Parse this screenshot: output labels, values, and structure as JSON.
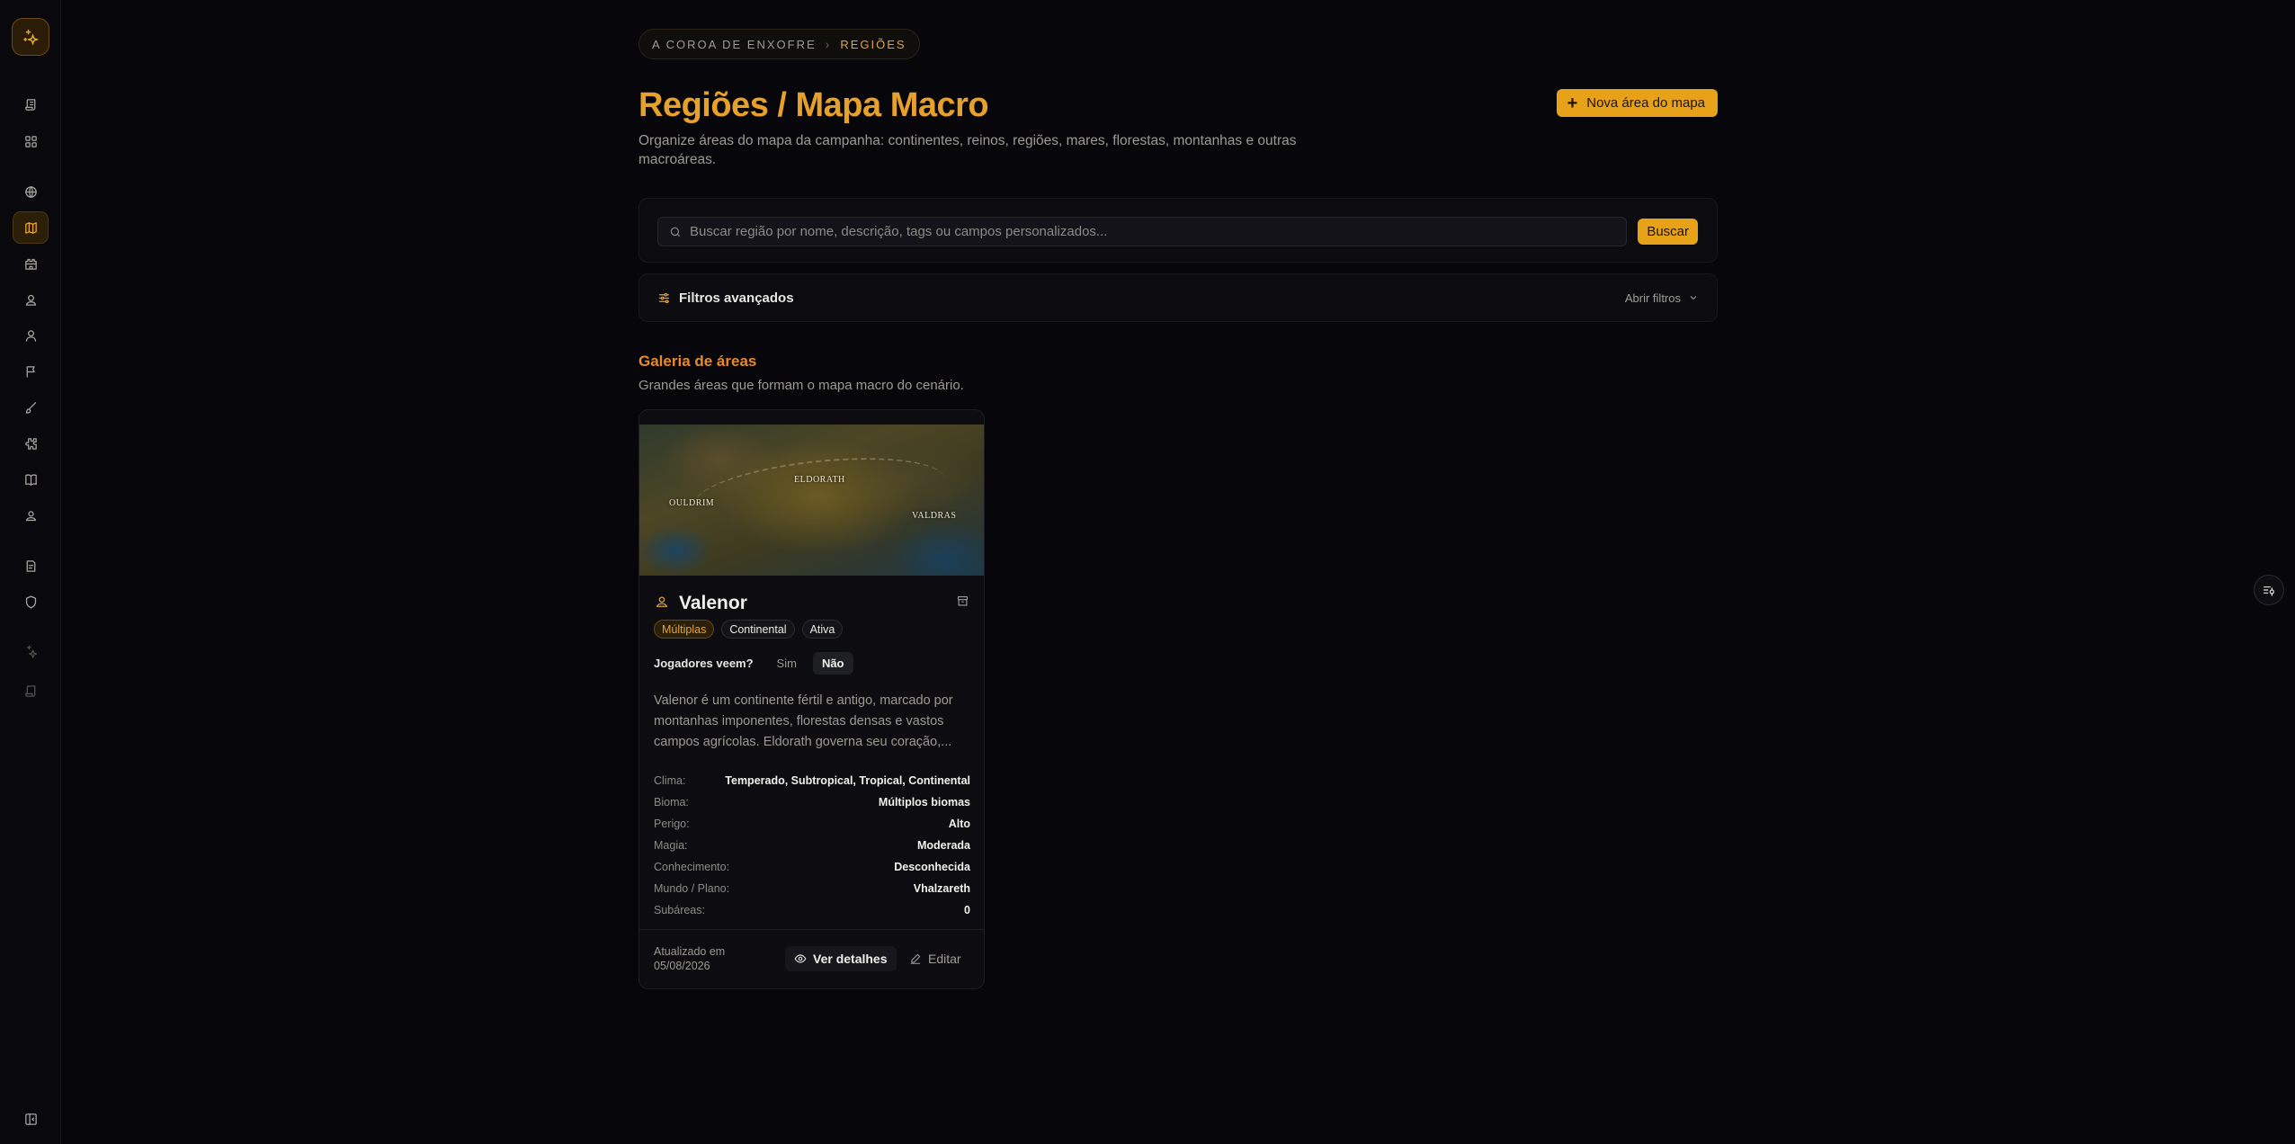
{
  "colors": {
    "accent": "#e8a219",
    "accent_text": "#e6a02c",
    "gallery_title": "#e88a2a",
    "background": "#07070b"
  },
  "sidebar": {
    "logo_icon": "sparkles-icon",
    "items": [
      {
        "icon": "scroll-icon"
      },
      {
        "icon": "grid-icon"
      },
      {
        "icon": "globe-icon"
      },
      {
        "icon": "map-icon",
        "active": true
      },
      {
        "icon": "castle-icon"
      },
      {
        "icon": "users-icon"
      },
      {
        "icon": "user-icon"
      },
      {
        "icon": "flag-icon"
      },
      {
        "icon": "brush-icon"
      },
      {
        "icon": "puzzle-icon"
      },
      {
        "icon": "book-icon"
      },
      {
        "icon": "person-pin-icon"
      },
      {
        "icon": "notes-icon"
      },
      {
        "icon": "shield-icon"
      },
      {
        "icon": "sparkles-small-icon"
      },
      {
        "icon": "scroll-small-icon"
      },
      {
        "icon": "panel-toggle-icon"
      }
    ]
  },
  "breadcrumb": {
    "root": "A COROA DE ENXOFRE",
    "separator": "›",
    "current": "REGIÕES"
  },
  "header": {
    "title": "Regiões / Mapa Macro",
    "description": "Organize áreas do mapa da campanha: continentes, reinos, regiões, mares, florestas, montanhas e outras macroáreas.",
    "new_button": "Nova área do mapa"
  },
  "search": {
    "placeholder": "Buscar região por nome, descrição, tags ou campos personalizados...",
    "button": "Buscar"
  },
  "filters": {
    "label": "Filtros avançados",
    "toggle": "Abrir filtros"
  },
  "gallery": {
    "title": "Galeria de áreas",
    "subtitle": "Grandes áreas que formam o mapa macro do cenário."
  },
  "card": {
    "map_labels": {
      "center": "ELDORATH",
      "left": "OULDRIM",
      "right": "VALDRAS"
    },
    "name": "Valenor",
    "badges": [
      "Múltiplas",
      "Continental",
      "Ativa"
    ],
    "players_question": "Jogadores veem?",
    "players_options": [
      "Sim",
      "Não"
    ],
    "players_selected": "Não",
    "description": "Valenor é um continente fértil e antigo, marcado por montanhas imponentes, florestas densas e vastos campos agrícolas. Eldorath governa seu coração,...",
    "attributes": [
      {
        "label": "Clima:",
        "value": "Temperado, Subtropical, Tropical, Continental"
      },
      {
        "label": "Bioma:",
        "value": "Múltiplos biomas"
      },
      {
        "label": "Perigo:",
        "value": "Alto"
      },
      {
        "label": "Magia:",
        "value": "Moderada"
      },
      {
        "label": "Conhecimento:",
        "value": "Desconhecida"
      },
      {
        "label": "Mundo / Plano:",
        "value": "Vhalzareth"
      },
      {
        "label": "Subáreas:",
        "value": "0"
      }
    ],
    "updated": "Atualizado em 05/08/2026",
    "details_button": "Ver detalhes",
    "edit_button": "Editar"
  }
}
